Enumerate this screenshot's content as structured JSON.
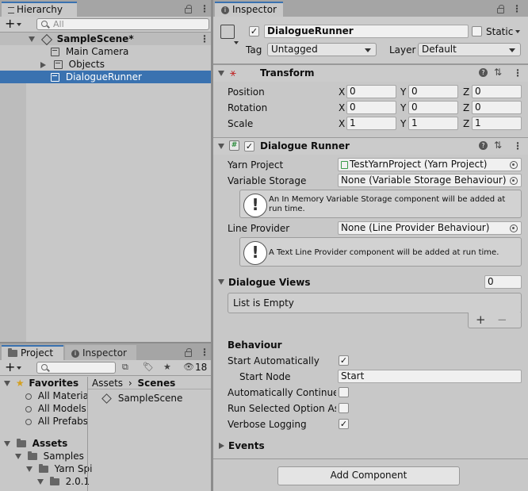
{
  "hierarchy": {
    "tab_label": "Hierarchy",
    "search_placeholder": "All",
    "scene_name": "SampleScene*",
    "items": [
      {
        "label": "Main Camera"
      },
      {
        "label": "Objects"
      },
      {
        "label": "DialogueRunner"
      }
    ]
  },
  "project": {
    "tab_label": "Project",
    "inspector_tab_label": "Inspector",
    "hidden_count": "18",
    "favorites_label": "Favorites",
    "favorites": [
      "All Materia",
      "All Models",
      "All Prefabs"
    ],
    "assets_label": "Assets",
    "tree": [
      "Samples",
      "Yarn Spi",
      "2.0.1"
    ],
    "breadcrumb": [
      "Assets",
      "Scenes"
    ],
    "files": [
      "SampleScene"
    ]
  },
  "inspector": {
    "tab_label": "Inspector",
    "object_name": "DialogueRunner",
    "static_label": "Static",
    "tag_label": "Tag",
    "tag_value": "Untagged",
    "layer_label": "Layer",
    "layer_value": "Default",
    "transform": {
      "title": "Transform",
      "rows": [
        {
          "label": "Position",
          "x": "0",
          "y": "0",
          "z": "0"
        },
        {
          "label": "Rotation",
          "x": "0",
          "y": "0",
          "z": "0"
        },
        {
          "label": "Scale",
          "x": "1",
          "y": "1",
          "z": "1"
        }
      ],
      "axis_x": "X",
      "axis_y": "Y",
      "axis_z": "Z"
    },
    "dialogue_runner": {
      "title": "Dialogue Runner",
      "yarn_project_label": "Yarn Project",
      "yarn_project_value": "TestYarnProject (Yarn Project)",
      "variable_storage_label": "Variable Storage",
      "variable_storage_value": "None (Variable Storage Behaviour)",
      "variable_storage_help": "An In Memory Variable Storage component will be added at run time.",
      "line_provider_label": "Line Provider",
      "line_provider_value": "None (Line Provider Behaviour)",
      "line_provider_help": "A Text Line Provider component will be added at run time.",
      "dialogue_views_label": "Dialogue Views",
      "dialogue_views_count": "0",
      "list_empty": "List is Empty",
      "plus": "+",
      "minus": "−",
      "behaviour_label": "Behaviour",
      "start_automatically_label": "Start Automatically",
      "start_automatically": true,
      "start_node_label": "Start Node",
      "start_node_value": "Start",
      "auto_continue_label": "Automatically Continue L",
      "auto_continue": false,
      "run_selected_label": "Run Selected Option As l",
      "run_selected": false,
      "verbose_label": "Verbose Logging",
      "verbose": true,
      "events_label": "Events"
    },
    "add_component_label": "Add Component"
  },
  "colors": {
    "accent": "#3a72b0",
    "panel": "#c8c8c8",
    "background": "#a5a5a5"
  }
}
